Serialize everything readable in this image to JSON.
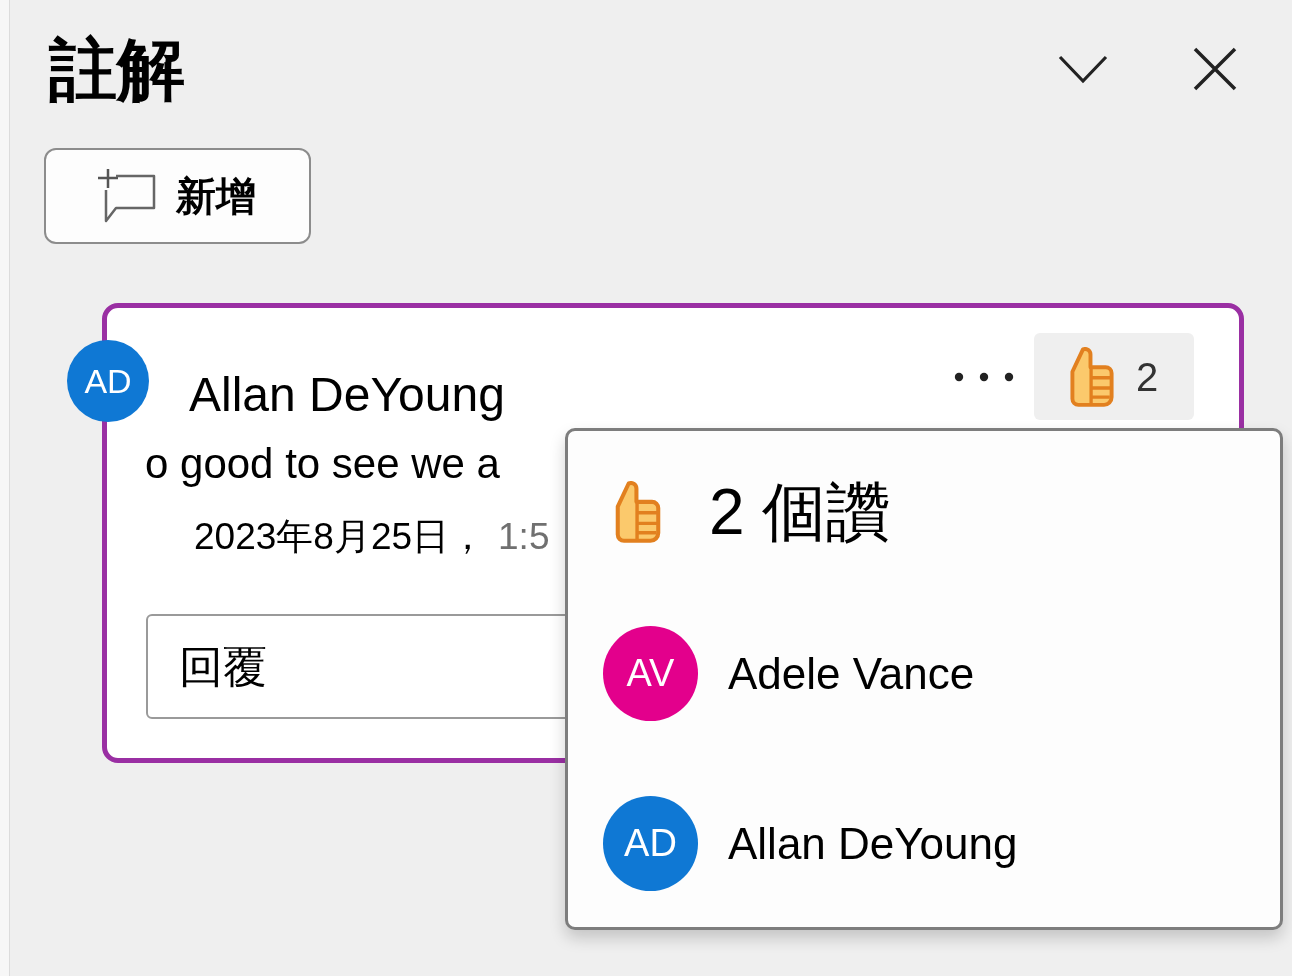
{
  "panel": {
    "title": "註解"
  },
  "add_button": {
    "label": "新增"
  },
  "comment": {
    "author": {
      "initials": "AD",
      "name": "Allan DeYoung"
    },
    "body": "o good to see we a",
    "date": "2023年8月25日，",
    "time": "1:5",
    "likes": {
      "count": "2"
    },
    "reply": {
      "placeholder": "回覆"
    }
  },
  "likes_popup": {
    "title": "2 個讚",
    "people": [
      {
        "initials": "AV",
        "name": "Adele Vance",
        "color": "#e3008c"
      },
      {
        "initials": "AD",
        "name": "Allan DeYoung",
        "color": "#0f78d4"
      }
    ]
  }
}
